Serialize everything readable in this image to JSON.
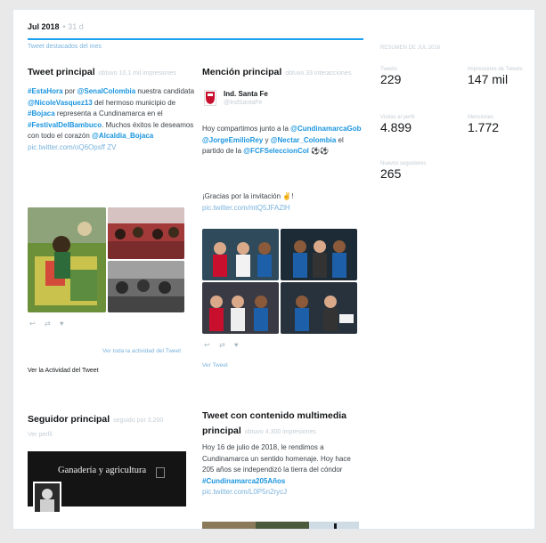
{
  "header": {
    "month": "Jul 2018",
    "month_suffix": "• 31 d",
    "subtitle": "Tweet destacados del mes"
  },
  "top_tweet": {
    "title": "Tweet principal",
    "title_meta": "obtuvo 10,1 mil impresiones",
    "text_parts": [
      {
        "t": "#EstaHora",
        "link": true
      },
      {
        "t": " por ",
        "link": false
      },
      {
        "t": "@SenalColombia",
        "link": true
      },
      {
        "t": " nuestra candidata ",
        "link": false
      },
      {
        "t": "@NicoleVasquez13",
        "link": true
      },
      {
        "t": " del hermoso municipio de ",
        "link": false
      },
      {
        "t": "#Bojaca",
        "link": true
      },
      {
        "t": " representa a Cundinamarca en el ",
        "link": false
      },
      {
        "t": "#FestivalDelBambuco",
        "link": true
      },
      {
        "t": ". Muchos éxitos le deseamos con todo el corazón ",
        "link": false
      },
      {
        "t": "@Alcaldia_Bojaca",
        "link": true
      }
    ],
    "url": "pic.twitter.com/oQ6Opsff ZV",
    "reply_icon": "reply-icon",
    "retweet_icon": "retweet-icon",
    "like_icon": "heart-icon",
    "activity_link": "Ver toda la actividad del Tweet",
    "activity_footer": "Ver la Actividad del Tweet"
  },
  "top_mention": {
    "title": "Mención principal",
    "title_meta": "obtuvo 33 interacciones",
    "account_name": "Ind. Santa Fe",
    "account_handle": "@IndSantaFe",
    "text_parts": [
      {
        "t": "Hoy compartimos junto a la ",
        "link": false
      },
      {
        "t": "@CundinamarcaGob",
        "link": true
      },
      {
        "t": " ",
        "link": false
      },
      {
        "t": "@JorgeEmilioRey",
        "link": true
      },
      {
        "t": " y ",
        "link": false
      },
      {
        "t": "@Nectar_Colombia",
        "link": true
      },
      {
        "t": " el partido de la ",
        "link": false
      },
      {
        "t": "@FCFSeleccionCol",
        "link": true
      },
      {
        "t": " ⚽⚽",
        "link": false
      }
    ],
    "text2": "¡Gracias por la invitación ✌!",
    "url": "pic.twitter.com/mtQ5JFAZlH",
    "activity_link": "Ver Tweet"
  },
  "stats": {
    "heading": "RESUMEN DE JUL 2018",
    "items": [
      {
        "label": "Tweets",
        "value": "229"
      },
      {
        "label": "Impresiones de Tweets",
        "value": "147 mil"
      },
      {
        "label": "Visitas al perfil",
        "value": "4.899"
      },
      {
        "label": "Menciones",
        "value": "1.772"
      },
      {
        "label": "Nuevos seguidores",
        "value": "265"
      }
    ]
  },
  "top_follower": {
    "title": "Seguidor principal",
    "title_meta": "seguido por 3.200",
    "sub": "Ver perfil",
    "banner_text": "Ganadería y agricultura"
  },
  "top_media": {
    "title": "Tweet con contenido multimedia principal",
    "title_meta": "obtuvo 4.300 impresiones",
    "text_parts": [
      {
        "t": "Hoy 16 de julio de 2018, le rendimos a Cundinamarca un sentido homenaje. Hoy hace 205 años se independizó la tierra del cóndor ",
        "link": false
      },
      {
        "t": "#Cundinamarca205Años",
        "link": true
      }
    ],
    "url": "pic.twitter.com/L0P5n2rycJ"
  }
}
